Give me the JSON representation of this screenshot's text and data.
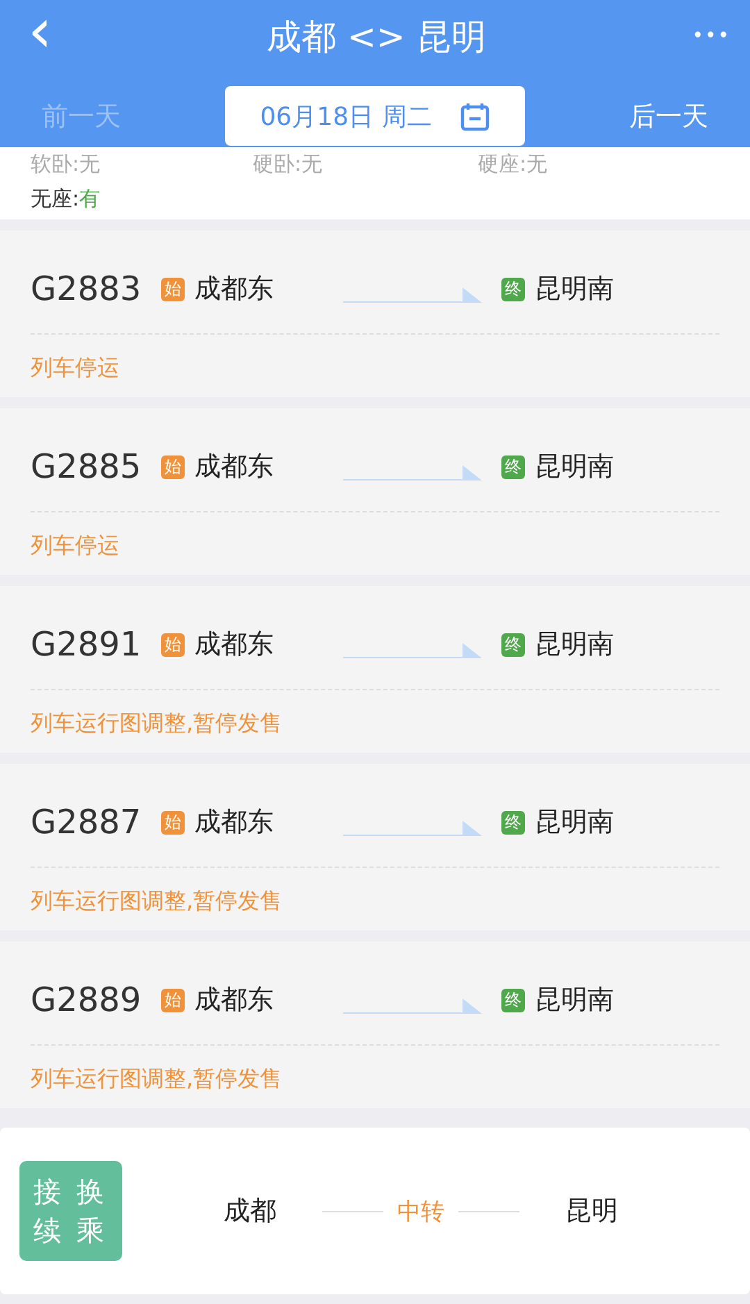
{
  "header": {
    "back": "‹",
    "title": "成都 <> 昆明",
    "more": "•••"
  },
  "date_bar": {
    "prev": {
      "label": "前一天",
      "disabled": true
    },
    "date": "06月18日 周二",
    "next": {
      "label": "后一天",
      "disabled": false
    }
  },
  "seats": [
    {
      "label": "软卧:",
      "value": "无",
      "available": false
    },
    {
      "label": "硬卧:",
      "value": "无",
      "available": false
    },
    {
      "label": "硬座:",
      "value": "无",
      "available": false
    },
    {
      "label": "无座:",
      "value": "有",
      "available": true
    }
  ],
  "trains": [
    {
      "number": "G2883",
      "from_tag": "始",
      "from": "成都东",
      "to_tag": "终",
      "to": "昆明南",
      "status": "列车停运"
    },
    {
      "number": "G2885",
      "from_tag": "始",
      "from": "成都东",
      "to_tag": "终",
      "to": "昆明南",
      "status": "列车停运"
    },
    {
      "number": "G2891",
      "from_tag": "始",
      "from": "成都东",
      "to_tag": "终",
      "to": "昆明南",
      "status": "列车运行图调整,暂停发售"
    },
    {
      "number": "G2887",
      "from_tag": "始",
      "from": "成都东",
      "to_tag": "终",
      "to": "昆明南",
      "status": "列车运行图调整,暂停发售"
    },
    {
      "number": "G2889",
      "from_tag": "始",
      "from": "成都东",
      "to_tag": "终",
      "to": "昆明南",
      "status": "列车运行图调整,暂停发售"
    }
  ],
  "transfer": {
    "badge": "接换续乘",
    "from": "成都",
    "via": "中转",
    "to": "昆明"
  }
}
